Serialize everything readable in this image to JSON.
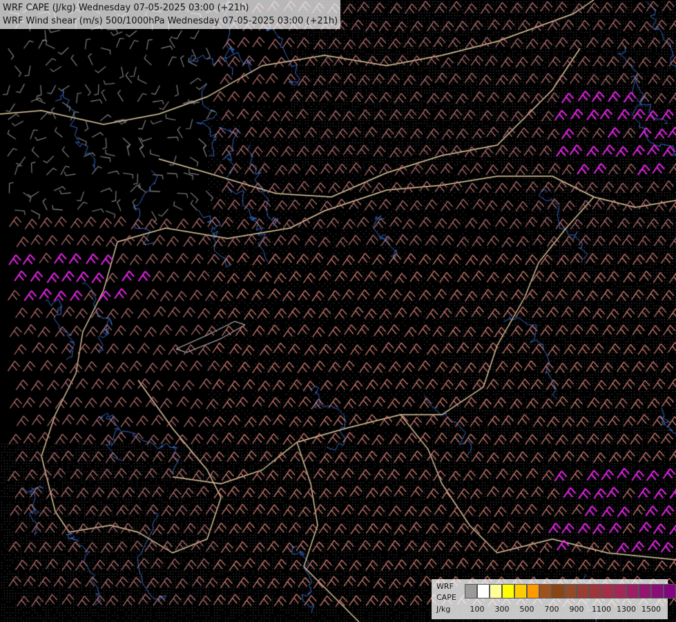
{
  "header": {
    "line1": "WRF CAPE (J/kg) Wednesday 07-05-2025 03:00 (+21h)",
    "line2": "WRF Wind shear (m/s) 500/1000hPa Wednesday 07-05-2025 03:00 (+21h)"
  },
  "legend": {
    "label_line1": "WRF",
    "label_line2": "CAPE",
    "label_line3": "J/kg",
    "ticks": [
      "100",
      "300",
      "500",
      "700",
      "900",
      "1100",
      "1300",
      "1500"
    ],
    "colors": [
      "#9a9a9a",
      "#ffffff",
      "#ffff99",
      "#ffff00",
      "#ffcc00",
      "#ff9900",
      "#a0521e",
      "#8b4513",
      "#934a28",
      "#9a3d33",
      "#a0343d",
      "#a52d48",
      "#a42856",
      "#9c1f63",
      "#921670",
      "#8a0d78",
      "#82057f"
    ]
  },
  "colors": {
    "barb_gray": "#8c8c8c",
    "barb_rose": "#c47a7a",
    "barb_salmon": "#e3897f",
    "barb_magenta": "#e626e6",
    "border": "#e8d2a6",
    "river": "#3b6cc8"
  }
}
